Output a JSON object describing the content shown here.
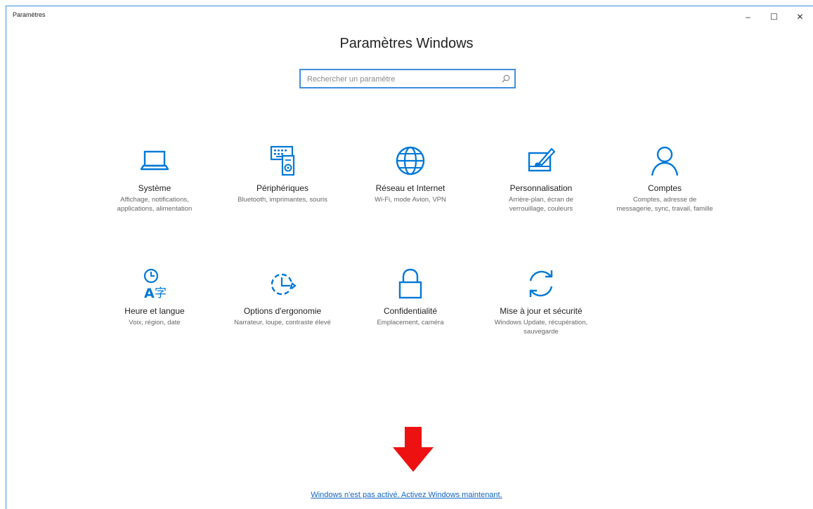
{
  "window": {
    "title": "Paramètres"
  },
  "controls": {
    "minimize": "–",
    "maximize": "☐",
    "close": "✕"
  },
  "header": {
    "title": "Paramètres Windows"
  },
  "search": {
    "placeholder": "Rechercher un paramètre"
  },
  "categories": [
    {
      "label": "Système",
      "desc": "Affichage, notifications, applications, alimentation",
      "icon": "laptop-icon"
    },
    {
      "label": "Périphériques",
      "desc": "Bluetooth, imprimantes, souris",
      "icon": "devices-icon"
    },
    {
      "label": "Réseau et Internet",
      "desc": "Wi-Fi, mode Avion, VPN",
      "icon": "globe-icon"
    },
    {
      "label": "Personnalisation",
      "desc": "Arrière-plan, écran de verrouillage, couleurs",
      "icon": "paint-icon"
    },
    {
      "label": "Comptes",
      "desc": "Comptes, adresse de messagerie, sync, travail, famille",
      "icon": "person-icon"
    },
    {
      "label": "Heure et langue",
      "desc": "Voix, région, date",
      "icon": "time-language-icon"
    },
    {
      "label": "Options d'ergonomie",
      "desc": "Narrateur, loupe, contraste élevé",
      "icon": "ease-of-access-icon"
    },
    {
      "label": "Confidentialité",
      "desc": "Emplacement, caméra",
      "icon": "lock-icon"
    },
    {
      "label": "Mise à jour et sécurité",
      "desc": "Windows Update, récupération, sauvegarde",
      "icon": "update-icon"
    }
  ],
  "footer": {
    "activate_link": "Windows n'est pas activé. Activez Windows maintenant."
  },
  "colors": {
    "accent": "#0078d7",
    "arrow": "#ee1111",
    "link": "#1565c0"
  }
}
